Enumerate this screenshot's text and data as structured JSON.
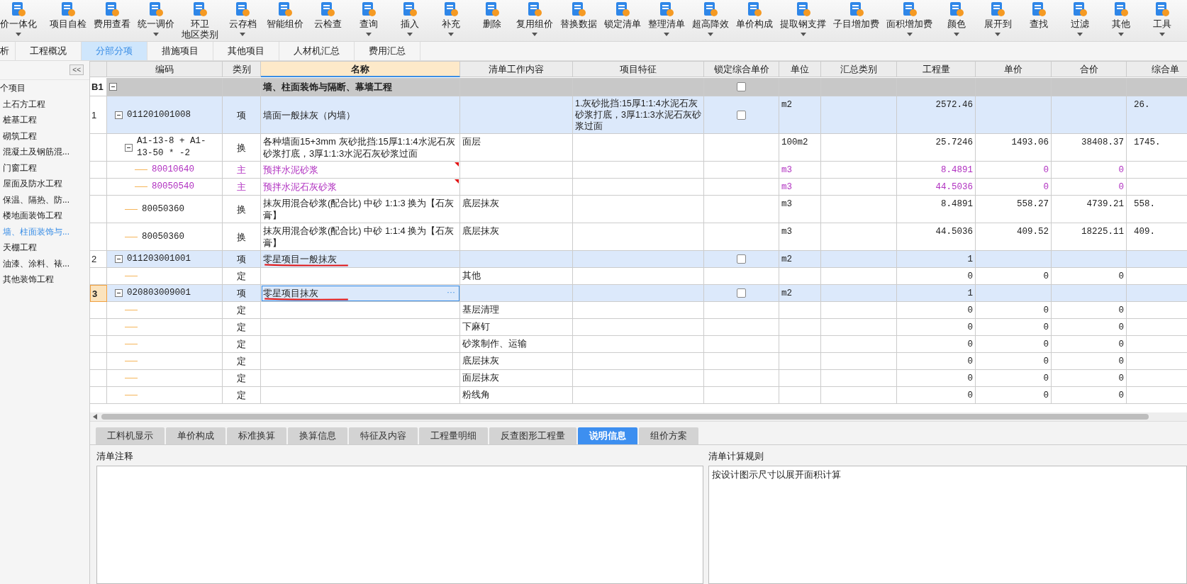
{
  "toolbar": [
    {
      "label": "价一体化",
      "dropdown": true
    },
    {
      "label": "项目自检",
      "dropdown": false
    },
    {
      "label": "费用查看",
      "dropdown": false
    },
    {
      "label": "统一调价",
      "dropdown": true
    },
    {
      "label": "环卫",
      "sublabel": "地区类别",
      "dropdown": false
    },
    {
      "label": "云存档",
      "dropdown": true
    },
    {
      "label": "智能组价",
      "dropdown": false
    },
    {
      "label": "云检查",
      "dropdown": false
    },
    {
      "label": "查询",
      "dropdown": true
    },
    {
      "label": "插入",
      "dropdown": true
    },
    {
      "label": "补充",
      "dropdown": true
    },
    {
      "label": "删除",
      "dropdown": false
    },
    {
      "label": "复用组价",
      "dropdown": true
    },
    {
      "label": "替换数据",
      "dropdown": false
    },
    {
      "label": "锁定清单",
      "dropdown": false
    },
    {
      "label": "整理清单",
      "dropdown": true
    },
    {
      "label": "超高降效",
      "dropdown": true
    },
    {
      "label": "单价构成",
      "dropdown": false
    },
    {
      "label": "提取钢支撑",
      "dropdown": true
    },
    {
      "label": "子目增加费",
      "dropdown": false
    },
    {
      "label": "面积增加费",
      "dropdown": true
    },
    {
      "label": "颜色",
      "dropdown": true
    },
    {
      "label": "展开到",
      "dropdown": true
    },
    {
      "label": "查找",
      "dropdown": false
    },
    {
      "label": "过滤",
      "dropdown": true
    },
    {
      "label": "其他",
      "dropdown": true
    },
    {
      "label": "工具",
      "dropdown": true
    }
  ],
  "tabs": [
    {
      "label": "析",
      "selected": false
    },
    {
      "label": "工程概况",
      "selected": false
    },
    {
      "label": "分部分项",
      "selected": true
    },
    {
      "label": "措施项目",
      "selected": false
    },
    {
      "label": "其他项目",
      "selected": false
    },
    {
      "label": "人材机汇总",
      "selected": false
    },
    {
      "label": "费用汇总",
      "selected": false
    }
  ],
  "sidebar": {
    "collapse": "<<",
    "items": [
      {
        "label": "个项目",
        "selected": false
      },
      {
        "label": "土石方工程",
        "selected": false
      },
      {
        "label": "桩基工程",
        "selected": false
      },
      {
        "label": "砌筑工程",
        "selected": false
      },
      {
        "label": "混凝土及钢筋混...",
        "selected": false
      },
      {
        "label": "门窗工程",
        "selected": false
      },
      {
        "label": "屋面及防水工程",
        "selected": false
      },
      {
        "label": "保温、隔热、防...",
        "selected": false
      },
      {
        "label": "楼地面装饰工程",
        "selected": false
      },
      {
        "label": "墙、柱面装饰与...",
        "selected": true
      },
      {
        "label": "天棚工程",
        "selected": false
      },
      {
        "label": "油漆、涂料、裱...",
        "selected": false
      },
      {
        "label": "其他装饰工程",
        "selected": false
      }
    ]
  },
  "table": {
    "columns": [
      "编码",
      "类别",
      "名称",
      "清单工作内容",
      "项目特征",
      "锁定综合单价",
      "单位",
      "汇总类别",
      "工程量",
      "单价",
      "合价",
      "综合单"
    ],
    "rows": [
      {
        "kind": "section",
        "num": "B1",
        "expanded": true,
        "name": "墙、柱面装饰与隔断、幕墙工程",
        "locked": false,
        "selected": false,
        "children": [
          {
            "kind": "item",
            "num": "1",
            "code": "011201001008",
            "expanded": true,
            "type": "项",
            "name": "墙面一般抹灰（内墙）",
            "feature": "1.灰砂批挡:15厚1:1:4水泥石灰砂浆打底，3厚1:1:3水泥石灰砂浆过面",
            "locked": false,
            "unit": "m2",
            "qty": "2572.46",
            "composite": "26.",
            "selected": false,
            "children": [
              {
                "kind": "sub",
                "code": "A1-13-8 + A1-13-50 * -2",
                "expanded": true,
                "type": "换",
                "name": "各种墙面15+3mm 灰砂批挡:15厚1:1:4水泥石灰砂浆打底，3厚1:1:3水泥石灰砂浆过面",
                "content": "面层",
                "unit": "100m2",
                "qty": "25.7246",
                "price": "1493.06",
                "total": "38408.37",
                "composite": "1745.",
                "selected": false,
                "children": [
                  {
                    "kind": "material",
                    "code": "80010640",
                    "type": "主",
                    "name": "预拌水泥砂浆",
                    "flagged": true,
                    "unit": "m3",
                    "qty": "8.4891",
                    "price": "0",
                    "total": "0",
                    "selected": false
                  },
                  {
                    "kind": "material",
                    "code": "80050540",
                    "type": "主",
                    "name": "预拌水泥石灰砂浆",
                    "flagged": true,
                    "unit": "m3",
                    "qty": "44.5036",
                    "price": "0",
                    "total": "0",
                    "selected": false
                  }
                ]
              },
              {
                "kind": "sub",
                "code": "80050360",
                "type": "换",
                "name": "抹灰用混合砂浆(配合比) 中砂 1:1:3 换为【石灰膏】",
                "content": "底层抹灰",
                "unit": "m3",
                "qty": "8.4891",
                "price": "558.27",
                "total": "4739.21",
                "composite": "558.",
                "selected": false
              },
              {
                "kind": "sub",
                "code": "80050360",
                "type": "换",
                "name": "抹灰用混合砂浆(配合比) 中砂 1:1:4 换为【石灰膏】",
                "content": "底层抹灰",
                "unit": "m3",
                "qty": "44.5036",
                "price": "409.52",
                "total": "18225.11",
                "composite": "409.",
                "selected": false
              }
            ]
          },
          {
            "kind": "item",
            "num": "2",
            "code": "011203001001",
            "expanded": true,
            "type": "项",
            "name": "零星项目一般抹灰",
            "underlined": true,
            "locked": false,
            "unit": "m2",
            "qty": "1",
            "selected": false,
            "children": [
              {
                "kind": "sub",
                "type": "定",
                "content": "其他",
                "qty": "0",
                "price": "0",
                "total": "0",
                "selected": false
              }
            ]
          },
          {
            "kind": "item",
            "num": "3",
            "code": "020803009001",
            "expanded": true,
            "type": "项",
            "name": "零星项目抹灰",
            "underlined": true,
            "ellipsis": "···",
            "locked": false,
            "unit": "m2",
            "qty": "1",
            "selected": true,
            "children": [
              {
                "kind": "sub",
                "type": "定",
                "content": "基层清理",
                "qty": "0",
                "price": "0",
                "total": "0",
                "selected": false
              },
              {
                "kind": "sub",
                "type": "定",
                "content": "下麻钉",
                "qty": "0",
                "price": "0",
                "total": "0",
                "selected": false
              },
              {
                "kind": "sub",
                "type": "定",
                "content": "砂浆制作、运输",
                "qty": "0",
                "price": "0",
                "total": "0",
                "selected": false
              },
              {
                "kind": "sub",
                "type": "定",
                "content": "底层抹灰",
                "qty": "0",
                "price": "0",
                "total": "0",
                "selected": false
              },
              {
                "kind": "sub",
                "type": "定",
                "content": "面层抹灰",
                "qty": "0",
                "price": "0",
                "total": "0",
                "selected": false
              },
              {
                "kind": "sub",
                "type": "定",
                "content": "粉线角",
                "qty": "0",
                "price": "0",
                "total": "0",
                "selected": false
              }
            ]
          }
        ]
      }
    ]
  },
  "bottom_tabs": [
    {
      "label": "工料机显示",
      "selected": false
    },
    {
      "label": "单价构成",
      "selected": false
    },
    {
      "label": "标准换算",
      "selected": false
    },
    {
      "label": "换算信息",
      "selected": false
    },
    {
      "label": "特征及内容",
      "selected": false
    },
    {
      "label": "工程量明细",
      "selected": false
    },
    {
      "label": "反查图形工程量",
      "selected": false
    },
    {
      "label": "说明信息",
      "selected": true
    },
    {
      "label": "组价方案",
      "selected": false
    }
  ],
  "notes": {
    "label": "清单注释"
  },
  "rules": {
    "label": "清单计算规则",
    "value": "按设计图示尺寸以展开面积计算"
  }
}
